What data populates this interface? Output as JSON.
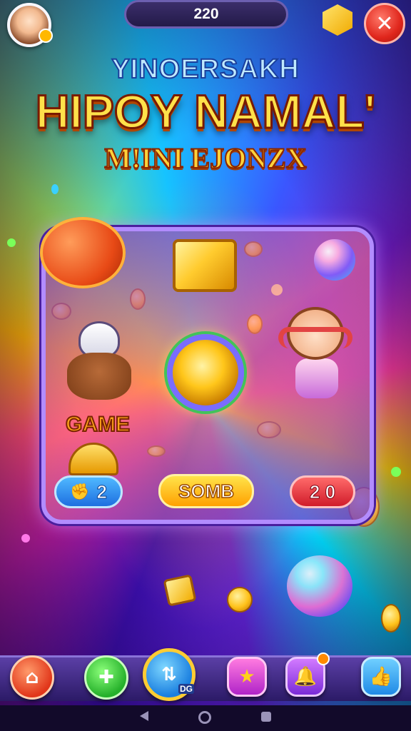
{
  "header": {
    "score": "220",
    "close_symbol": "✕"
  },
  "titles": {
    "top": "YINOERSAKH",
    "main": "HIPOY NAMAL'",
    "sub": "M!INI EJONZX"
  },
  "board": {
    "game_label": "GAME",
    "left_counter": "2",
    "left_counter_icon": "✊",
    "center_button": "SOMB",
    "right_counter": "2 0"
  },
  "nav": {
    "home_icon": "⌂",
    "plus_icon": "✚",
    "center_icon": "⇅",
    "center_tag": "DG",
    "star_icon": "★",
    "bell_icon": "🔔",
    "like_icon": "👍"
  },
  "colors": {
    "accent_gold": "#ffc61a",
    "close_red": "#e0261c",
    "board_border": "#b28cff"
  }
}
